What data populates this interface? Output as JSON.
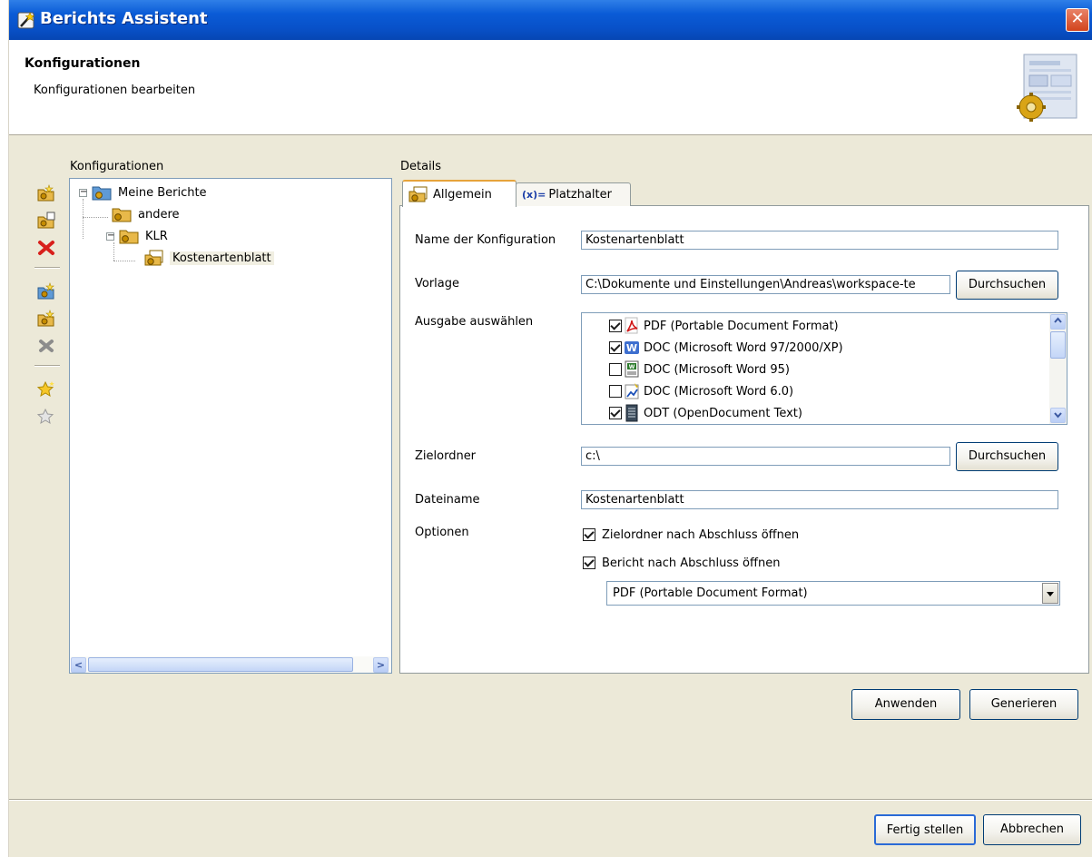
{
  "window": {
    "title": "Berichts Assistent",
    "close_label": "✕"
  },
  "header": {
    "title": "Konfigurationen",
    "description": "Konfigurationen bearbeiten"
  },
  "left": {
    "section_label": "Konfigurationen"
  },
  "toolbar": {
    "buttons": [
      "new-report-icon",
      "copy-report-icon",
      "delete-report-icon",
      "new-folder-icon",
      "new-subfolder-icon",
      "delete-folder-icon",
      "favorite-add-icon",
      "favorite-remove-icon"
    ]
  },
  "tree": {
    "root": "Meine Berichte",
    "items": [
      {
        "label": "andere"
      },
      {
        "label": "KLR"
      },
      {
        "label": "Kostenartenblatt",
        "selected": true
      }
    ],
    "expand_symbol": "−",
    "scroll_left": "<",
    "scroll_right": ">"
  },
  "details": {
    "section_label": "Details",
    "tabs": [
      "Allgemein",
      "Platzhalter"
    ],
    "placeholder_tab_prefix": "(x)=",
    "name_label": "Name der Konfiguration",
    "name_value": "Kostenartenblatt",
    "template_label": "Vorlage",
    "template_value": "C:\\Dokumente und Einstellungen\\Andreas\\workspace-te",
    "browse_label": "Durchsuchen",
    "output_label": "Ausgabe auswählen",
    "outputs": [
      {
        "label": "PDF  (Portable Document Format)",
        "checked": true,
        "icon": "pdf-icon"
      },
      {
        "label": "DOC  (Microsoft Word 97/2000/XP)",
        "checked": true,
        "icon": "word-icon"
      },
      {
        "label": "DOC  (Microsoft Word 95)",
        "checked": false,
        "icon": "word95-icon"
      },
      {
        "label": "DOC  (Microsoft Word 6.0)",
        "checked": false,
        "icon": "word6-icon"
      },
      {
        "label": "ODT  (OpenDocument Text)",
        "checked": true,
        "icon": "odt-icon"
      }
    ],
    "target_folder_label": "Zielordner",
    "target_folder_value": "c:\\",
    "filename_label": "Dateiname",
    "filename_value": "Kostenartenblatt",
    "options_label": "Optionen",
    "options": [
      {
        "label": "Zielordner nach Abschluss öffnen",
        "checked": true
      },
      {
        "label": "Bericht nach Abschluss öffnen",
        "checked": true
      }
    ],
    "open_format_value": "PDF  (Portable Document Format)"
  },
  "actions": {
    "apply": "Anwenden",
    "generate": "Generieren"
  },
  "footer": {
    "finish": "Fertig stellen",
    "cancel": "Abbrechen"
  },
  "colors": {
    "title_bar": "#0a5bd6",
    "dialog_bg": "#ece9d8",
    "tab_accent": "#e6a33b",
    "close_button": "#d2431c"
  }
}
